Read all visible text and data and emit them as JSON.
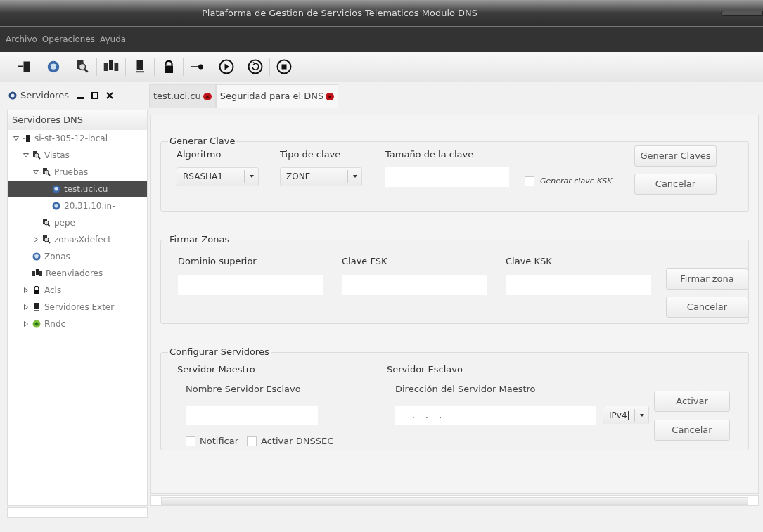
{
  "window": {
    "title": "Plataforma de Gestion de Servicios Telematicos Modulo DNS"
  },
  "menu": [
    "Archivo",
    "Operaciones",
    "Ayuda"
  ],
  "side_panel": {
    "title": "Servidores",
    "tree_title": "Servidores DNS",
    "tree": [
      {
        "label": "si-st-305-12-local",
        "kind": "server",
        "expanded": true,
        "selected": false,
        "children": [
          {
            "label": "Vistas",
            "kind": "view",
            "expanded": true,
            "selected": false,
            "children": [
              {
                "label": "Pruebas",
                "kind": "view",
                "expanded": true,
                "selected": false,
                "children": [
                  {
                    "label": "test.uci.cu",
                    "kind": "zone",
                    "selected": true
                  },
                  {
                    "label": "20.31.10.in-",
                    "kind": "zone",
                    "selected": false
                  }
                ]
              },
              {
                "label": "pepe",
                "kind": "view",
                "selected": false
              },
              {
                "label": "zonasXdefect",
                "kind": "view",
                "expanded": false,
                "selected": false
              }
            ]
          },
          {
            "label": "Zonas",
            "kind": "zone",
            "selected": false
          },
          {
            "label": "Reenviadores",
            "kind": "forwarders",
            "selected": false
          },
          {
            "label": "Acls",
            "kind": "acl",
            "expanded": false,
            "selected": false
          },
          {
            "label": "Servidores Exter",
            "kind": "external",
            "expanded": false,
            "selected": false
          },
          {
            "label": "Rndc",
            "kind": "rndc",
            "expanded": false,
            "selected": false
          }
        ]
      }
    ]
  },
  "tabs": [
    {
      "label": "test.uci.cu",
      "selected": false
    },
    {
      "label": "Seguridad para el DNS",
      "selected": true
    }
  ],
  "generar_clave": {
    "title": "Generar Clave",
    "algoritmo": {
      "label": "Algoritmo",
      "value": "RSASHA1"
    },
    "tipo": {
      "label": "Tipo de clave",
      "value": "ZONE"
    },
    "tamano": {
      "label": "Tamaño de la clave"
    },
    "ksk": {
      "label": "Generar clave KSK",
      "checked": false
    },
    "buttons": [
      "Generar Claves",
      "Cancelar"
    ]
  },
  "firmar_zonas": {
    "title": "Firmar Zonas",
    "fields": [
      "Dominio superior",
      "Clave FSK",
      "Clave KSK"
    ],
    "buttons": [
      "Firmar zona",
      "Cancelar"
    ]
  },
  "configurar_servidores": {
    "title": "Configurar Servidores",
    "maestro": {
      "heading": "Servidor Maestro",
      "label": "Nombre Servidor Esclavo"
    },
    "esclavo": {
      "heading": "Servidor Esclavo",
      "label": "Dirección del Servidor Maestro",
      "value": ".    .    .",
      "protocol": "IPv4|"
    },
    "options": [
      {
        "label": "Notificar",
        "checked": false
      },
      {
        "label": "Activar DNSSEC",
        "checked": false
      }
    ],
    "buttons": [
      "Activar",
      "Cancelar"
    ]
  }
}
